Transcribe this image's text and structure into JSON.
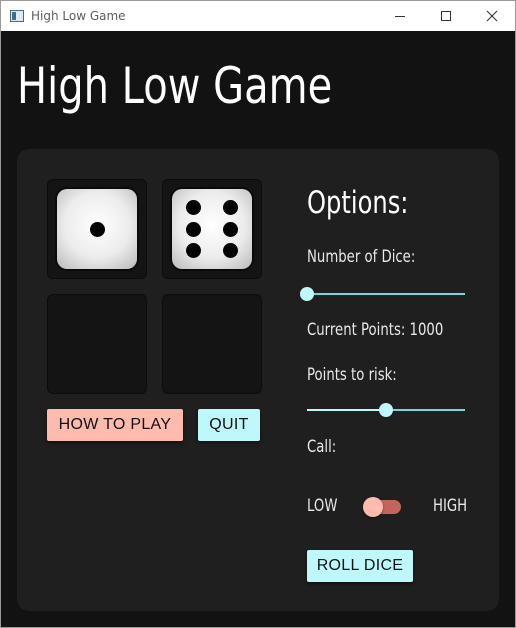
{
  "window": {
    "title": "High Low Game"
  },
  "app": {
    "title": "High Low Game"
  },
  "dice": [
    {
      "value": 1
    },
    {
      "value": 6
    },
    {
      "value": null
    },
    {
      "value": null
    }
  ],
  "buttons": {
    "how_to_play": "HOW TO PLAY",
    "quit": "QUIT",
    "roll_dice": "ROLL DICE"
  },
  "options": {
    "heading": "Options:",
    "number_of_dice_label": "Number of Dice:",
    "number_of_dice_slider": {
      "fraction": 0.0
    },
    "current_points_label": "Current Points: 1000",
    "points_to_risk_label": "Points to risk:",
    "points_to_risk_slider": {
      "fraction": 0.5
    },
    "call_label": "Call:",
    "call_low_label": "LOW",
    "call_high_label": "HIGH",
    "call_toggle_state": "low"
  },
  "colors": {
    "background": "#121212",
    "card": "#1f1f1f",
    "accent_pink": "#ffbcae",
    "accent_cyan": "#bff8fb"
  },
  "icons": {
    "app": "window-app-icon",
    "minimize": "minimize-icon",
    "maximize": "maximize-icon",
    "close": "close-icon"
  }
}
